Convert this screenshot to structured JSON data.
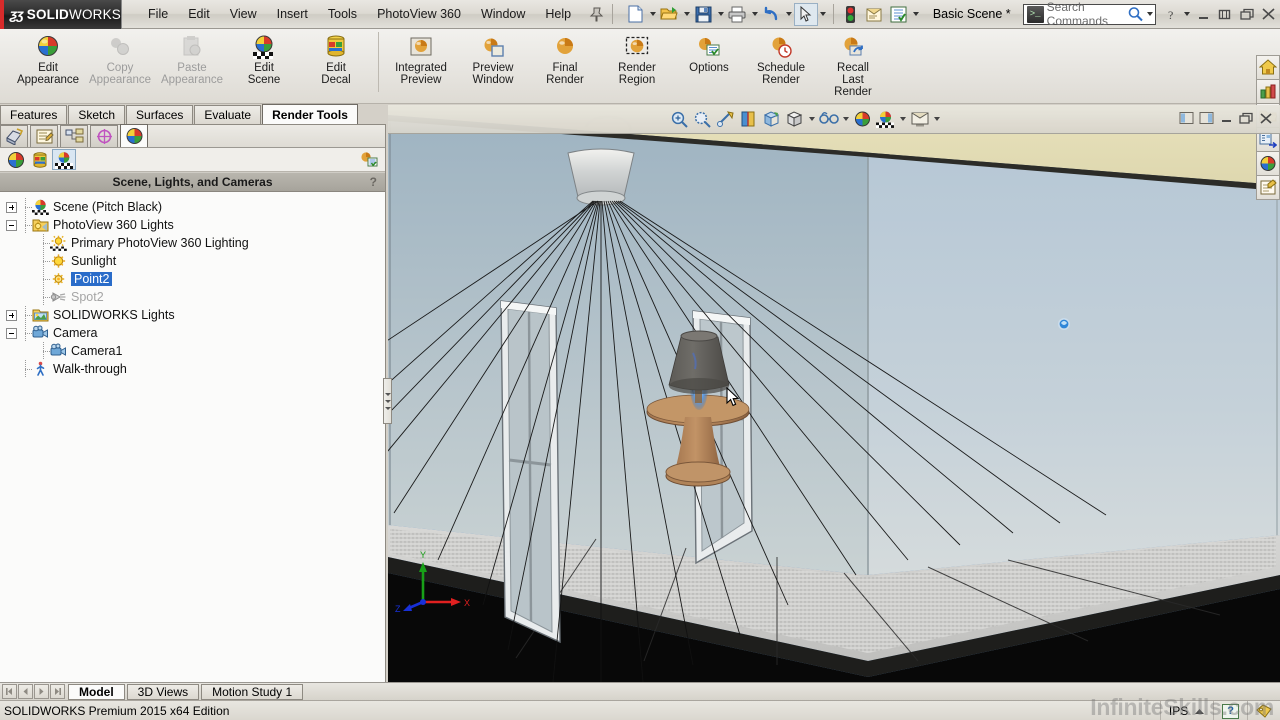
{
  "app": {
    "brand_ds": "ƺʒ",
    "brand_bold": "SOLID",
    "brand_light": "WORKS",
    "edition": "SOLIDWORKS Premium 2015 x64 Edition"
  },
  "menu": {
    "items": [
      "File",
      "Edit",
      "View",
      "Insert",
      "Tools",
      "PhotoView 360",
      "Window",
      "Help"
    ],
    "pin_icon": "pushpin-icon"
  },
  "quick_access": {
    "buttons": [
      {
        "name": "new-document-button",
        "icon": "new-document-icon",
        "has_arrow": true
      },
      {
        "name": "open-document-button",
        "icon": "open-folder-icon",
        "has_arrow": true
      },
      {
        "name": "save-button",
        "icon": "floppy-disk-icon",
        "has_arrow": true
      },
      {
        "name": "print-button",
        "icon": "printer-icon",
        "has_arrow": true
      },
      {
        "name": "undo-button",
        "icon": "undo-arrow-icon",
        "has_arrow": true
      },
      {
        "name": "select-button",
        "icon": "arrow-cursor-icon",
        "has_arrow": true,
        "pressed": true
      },
      {
        "name": "rebuild-button",
        "icon": "traffic-light-icon",
        "has_arrow": false
      },
      {
        "name": "file-properties-button",
        "icon": "document-properties-icon",
        "has_arrow": false
      },
      {
        "name": "options-button",
        "icon": "options-list-icon",
        "has_arrow": true
      }
    ],
    "scene_name": "Basic Scene *"
  },
  "search": {
    "placeholder": "Search Commands",
    "icon": "command-prompt-icon",
    "magnifier": "magnifier-icon"
  },
  "window_controls": {
    "help": "?",
    "minimize": "minimize-icon",
    "restore": "restore-icon",
    "maximize": "maximize-icon",
    "close": "close-icon"
  },
  "ribbon": {
    "groups": [
      {
        "buttons": [
          {
            "label": "Edit\nAppearance",
            "icon": "appearance-sphere-icon",
            "disabled": false,
            "name": "edit-appearance-button"
          },
          {
            "label": "Copy\nAppearance",
            "icon": "copy-appearance-icon",
            "disabled": true,
            "name": "copy-appearance-button"
          },
          {
            "label": "Paste\nAppearance",
            "icon": "paste-appearance-icon",
            "disabled": true,
            "name": "paste-appearance-button"
          },
          {
            "label": "Edit\nScene",
            "icon": "edit-scene-icon",
            "disabled": false,
            "name": "edit-scene-button"
          },
          {
            "label": "Edit\nDecal",
            "icon": "edit-decal-icon",
            "disabled": false,
            "name": "edit-decal-button"
          }
        ]
      },
      {
        "buttons": [
          {
            "label": "Integrated\nPreview",
            "icon": "integrated-preview-icon",
            "disabled": false,
            "name": "integrated-preview-button"
          },
          {
            "label": "Preview\nWindow",
            "icon": "preview-window-icon",
            "disabled": false,
            "name": "preview-window-button"
          },
          {
            "label": "Final\nRender",
            "icon": "final-render-icon",
            "disabled": false,
            "name": "final-render-button"
          },
          {
            "label": "Render\nRegion",
            "icon": "render-region-icon",
            "disabled": false,
            "name": "render-region-button"
          },
          {
            "label": "Options",
            "icon": "render-options-icon",
            "disabled": false,
            "name": "render-options-button"
          },
          {
            "label": "Schedule\nRender",
            "icon": "schedule-render-icon",
            "disabled": false,
            "name": "schedule-render-button"
          },
          {
            "label": "Recall\nLast\nRender",
            "icon": "recall-render-icon",
            "disabled": false,
            "name": "recall-last-render-button"
          }
        ]
      }
    ]
  },
  "command_tabs": {
    "items": [
      {
        "label": "Features",
        "active": false
      },
      {
        "label": "Sketch",
        "active": false
      },
      {
        "label": "Surfaces",
        "active": false
      },
      {
        "label": "Evaluate",
        "active": false
      },
      {
        "label": "Render Tools",
        "active": true
      }
    ]
  },
  "feature_manager": {
    "tabs": [
      {
        "name": "feature-tree-tab",
        "icon": "feature-tree-icon",
        "active": false
      },
      {
        "name": "property-manager-tab",
        "icon": "property-manager-icon",
        "active": false
      },
      {
        "name": "configuration-manager-tab",
        "icon": "configuration-manager-icon",
        "active": false
      },
      {
        "name": "dimxpert-manager-tab",
        "icon": "dimxpert-icon",
        "active": false
      },
      {
        "name": "display-manager-tab",
        "icon": "appearance-sphere-icon",
        "active": true
      }
    ],
    "subbar_buttons": [
      {
        "name": "view-appearances-button",
        "icon": "appearance-sphere-icon",
        "pressed": false
      },
      {
        "name": "view-decals-button",
        "icon": "decal-cylinder-icon",
        "pressed": false
      },
      {
        "name": "view-scene-lights-cameras-button",
        "icon": "scene-lights-cameras-icon",
        "pressed": true
      }
    ],
    "subbar_right": {
      "name": "display-options-button",
      "icon": "display-options-icon"
    },
    "panel_title": "Scene, Lights, and Cameras",
    "help_glyph": "?"
  },
  "tree": {
    "nodes": [
      {
        "label": "Scene (Pitch Black)",
        "icon": "scene-icon",
        "depth": 0,
        "toggle": "plus",
        "state": "normal"
      },
      {
        "label": "PhotoView 360 Lights",
        "icon": "photoview-lights-folder-icon",
        "depth": 0,
        "toggle": "minus",
        "state": "normal"
      },
      {
        "label": "Primary PhotoView 360 Lighting",
        "icon": "primary-lighting-icon",
        "depth": 1,
        "toggle": "none",
        "state": "normal"
      },
      {
        "label": "Sunlight",
        "icon": "sunlight-icon",
        "depth": 1,
        "toggle": "none",
        "state": "normal"
      },
      {
        "label": "Point2",
        "icon": "point-light-icon",
        "depth": 1,
        "toggle": "none",
        "state": "selected"
      },
      {
        "label": "Spot2",
        "icon": "spot-light-icon",
        "depth": 1,
        "toggle": "none",
        "state": "dimmed"
      },
      {
        "label": "SOLIDWORKS Lights",
        "icon": "solidworks-lights-folder-icon",
        "depth": 0,
        "toggle": "plus",
        "state": "normal"
      },
      {
        "label": "Camera",
        "icon": "camera-folder-icon",
        "depth": 0,
        "toggle": "minus",
        "state": "normal"
      },
      {
        "label": "Camera1",
        "icon": "camera-icon",
        "depth": 1,
        "toggle": "none",
        "state": "normal"
      },
      {
        "label": "Walk-through",
        "icon": "walk-through-icon",
        "depth": 0,
        "toggle": "none",
        "state": "normal"
      }
    ]
  },
  "view_toolbar": {
    "buttons": [
      {
        "name": "zoom-to-fit-button",
        "icon": "zoom-to-fit-icon",
        "arrow": false
      },
      {
        "name": "zoom-to-area-button",
        "icon": "zoom-to-area-icon",
        "arrow": false
      },
      {
        "name": "previous-view-button",
        "icon": "previous-view-icon",
        "arrow": false
      },
      {
        "name": "section-view-button",
        "icon": "section-view-icon",
        "arrow": false
      },
      {
        "name": "view-orientation-button",
        "icon": "view-orientation-icon",
        "arrow": false
      },
      {
        "name": "display-style-button",
        "icon": "display-style-icon",
        "arrow": true
      },
      {
        "name": "hide-show-items-button",
        "icon": "hide-show-items-icon",
        "arrow": true
      },
      {
        "name": "edit-appearance-view-button",
        "icon": "appearance-sphere-icon",
        "arrow": true
      },
      {
        "name": "apply-scene-button",
        "icon": "apply-scene-icon",
        "arrow": true
      },
      {
        "name": "view-settings-button",
        "icon": "view-settings-icon",
        "arrow": true
      }
    ],
    "window_buttons": [
      {
        "name": "tile-left-button",
        "icon": "tile-left-icon"
      },
      {
        "name": "tile-right-button",
        "icon": "tile-right-icon"
      },
      {
        "name": "doc-minimize-button",
        "icon": "minimize-icon"
      },
      {
        "name": "doc-restore-button",
        "icon": "restore-icon"
      },
      {
        "name": "doc-close-button",
        "icon": "close-icon"
      }
    ]
  },
  "right_toolbar": {
    "buttons": [
      {
        "name": "home-task-button",
        "icon": "home-icon"
      },
      {
        "name": "design-library-button",
        "icon": "design-library-icon"
      },
      {
        "name": "file-explorer-button",
        "icon": "folder-icon"
      },
      {
        "name": "view-palette-button",
        "icon": "view-palette-icon"
      },
      {
        "name": "appearances-scenes-button",
        "icon": "appearance-sphere-icon"
      },
      {
        "name": "custom-properties-button",
        "icon": "custom-properties-icon"
      }
    ]
  },
  "viewport": {
    "triad": {
      "x_label": "X",
      "y_label": "Y",
      "z_label": "Z",
      "x_color": "#e02020",
      "y_color": "#18a018",
      "z_color": "#1830d8"
    },
    "marker": {
      "name": "point-light-marker",
      "color": "#2f86d8"
    },
    "scene_description": "Room interior with ceiling light casting rays, two windows, and a table lamp"
  },
  "bottom_tabs": {
    "nav": [
      "first-icon",
      "previous-icon",
      "next-icon",
      "last-icon"
    ],
    "items": [
      {
        "label": "Model",
        "active": true
      },
      {
        "label": "3D Views",
        "active": false
      },
      {
        "label": "Motion Study 1",
        "active": false
      }
    ]
  },
  "status_bar": {
    "left_text": "SOLIDWORKS Premium 2015 x64 Edition",
    "units": "IPS",
    "units_arrow": "chevron-up-icon",
    "help_badge": "?",
    "tag_icon": "tag-icon"
  },
  "watermark": {
    "text": "InfiniteSkills.com"
  }
}
